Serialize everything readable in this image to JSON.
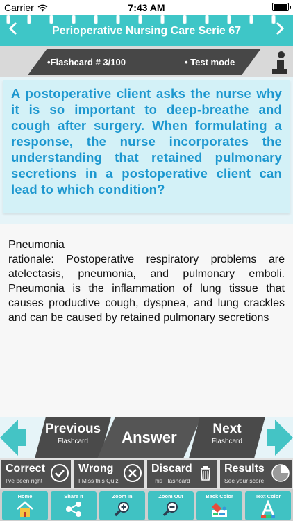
{
  "status_bar": {
    "carrier": "Carrier",
    "time": "7:43 AM"
  },
  "nav": {
    "title": "Perioperative Nursing Care Serie 67",
    "back_icon": "chevron-left-icon",
    "forward_icon": "chevron-right-icon"
  },
  "flashcard": {
    "counter": "•Flashcard #  3/100",
    "mode": "• Test mode"
  },
  "question": "A postoperative client asks the nurse why it is so important to deep-breathe and cough after surgery. When formulating a response, the nurse incorporates the understanding that retained pulmonary secretions in a postoperative client can lead to which condition?",
  "answer": {
    "title": "Pneumonia",
    "rationale": "rationale: Postoperative respiratory problems are atelectasis, pneumonia, and pulmonary emboli. Pneumonia is the inflammation of lung tissue that causes productive cough, dyspnea, and lung crackles and can be caused by retained pulmonary secretions"
  },
  "navigation": {
    "previous": {
      "label": "Previous",
      "sub": "Flashcard"
    },
    "answer": "Answer",
    "next": {
      "label": "Next",
      "sub": "Flashcard"
    }
  },
  "grading": {
    "correct": {
      "label": "Correct",
      "sub": "I've been right"
    },
    "wrong": {
      "label": "Wrong",
      "sub": "I Miss this Quiz"
    },
    "discard": {
      "label": "Discard",
      "sub": "This Flashcard"
    },
    "results": {
      "label": "Results",
      "sub": "See your score"
    }
  },
  "toolbar": {
    "home": "Home",
    "share": "Share It",
    "zoom_in": "Zoom In",
    "zoom_out": "Zoom Out",
    "back_color": "Back Color",
    "text_color": "Text Color"
  },
  "colors": {
    "accent": "#3ec6c7",
    "question_text": "#1d97cf",
    "dark_button": "#4a4a4a"
  }
}
